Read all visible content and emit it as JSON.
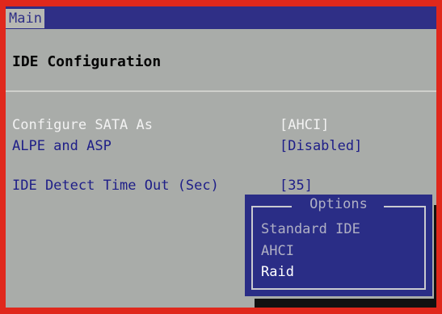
{
  "menu": {
    "tab_main": "Main"
  },
  "page": {
    "title": "IDE Configuration"
  },
  "settings": [
    {
      "label": "Configure SATA As",
      "value": "[AHCI]"
    },
    {
      "label": "ALPE and ASP",
      "value": "[Disabled]"
    },
    {
      "label": "IDE Detect Time Out (Sec)",
      "value": "[35]"
    }
  ],
  "popup": {
    "title": "Options",
    "options": [
      "Standard IDE",
      "AHCI",
      "Raid"
    ],
    "selected": "Raid"
  },
  "colors": {
    "frame": "#e0281c",
    "background": "#a9aca9",
    "menubar": "#2f2f86",
    "label_blue": "#1e1e88",
    "popup": "#2a2d86"
  }
}
